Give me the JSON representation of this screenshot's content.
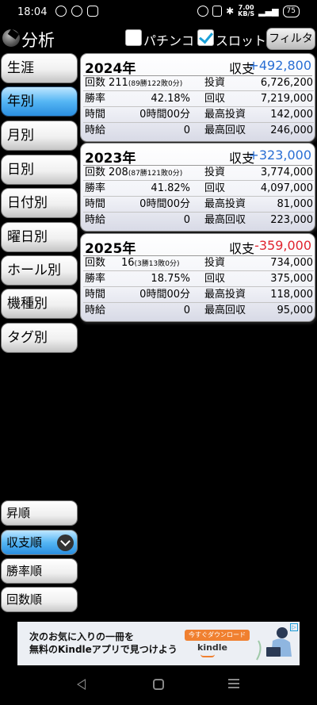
{
  "status_bar": {
    "time": "18:04",
    "net_speed_top": "7.00",
    "net_speed_unit": "KB/S",
    "battery": "75"
  },
  "header": {
    "title": "分析",
    "pachinko_label": "パチンコ",
    "pachinko_checked": false,
    "slot_label": "スロット",
    "slot_checked": true,
    "filter_label": "フィルタ"
  },
  "nav": {
    "items": [
      "生涯",
      "年別",
      "月別",
      "日別",
      "日付別",
      "曜日別",
      "ホール別",
      "機種別",
      "タグ別"
    ],
    "active_index": 1
  },
  "sort": {
    "items": [
      "昇順",
      "収支順",
      "勝率順",
      "回数順"
    ],
    "active_index": 1
  },
  "labels": {
    "balance": "収支",
    "count": "回数",
    "win_rate": "勝率",
    "time": "時間",
    "hourly": "時給",
    "investment": "投資",
    "recovery": "回収",
    "max_investment": "最高投資",
    "max_recovery": "最高回収"
  },
  "cards": [
    {
      "year": "2024年",
      "balance": "+492,800",
      "balance_sign": "pos",
      "count": "211",
      "count_detail": "(89勝122敗0分)",
      "win_rate": "42.18%",
      "time": "0時間00分",
      "hourly": "0",
      "investment": "6,726,200",
      "recovery": "7,219,000",
      "max_investment": "142,000",
      "max_recovery": "246,000"
    },
    {
      "year": "2023年",
      "balance": "+323,000",
      "balance_sign": "pos",
      "count": "208",
      "count_detail": "(87勝121敗0分)",
      "win_rate": "41.82%",
      "time": "0時間00分",
      "hourly": "0",
      "investment": "3,774,000",
      "recovery": "4,097,000",
      "max_investment": "81,000",
      "max_recovery": "223,000"
    },
    {
      "year": "2025年",
      "balance": "-359,000",
      "balance_sign": "neg",
      "count": "16",
      "count_detail": "(3勝13敗0分)",
      "win_rate": "18.75%",
      "time": "0時間00分",
      "hourly": "0",
      "investment": "734,000",
      "recovery": "375,000",
      "max_investment": "118,000",
      "max_recovery": "95,000"
    }
  ],
  "ad": {
    "line1": "次のお気に入りの一冊を",
    "line2": "無料のKindleアプリで見つけよう",
    "cta": "今すぐダウンロード",
    "brand": "kindle"
  },
  "colors": {
    "positive": "#2a6fd4",
    "negative": "#e0242f",
    "active_tab": "#55b6f4"
  }
}
